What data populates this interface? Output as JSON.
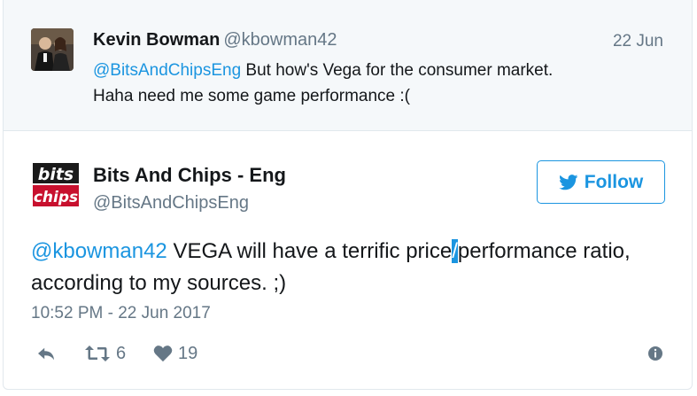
{
  "parent_tweet": {
    "author_name": "Kevin Bowman",
    "author_handle": "@kbowman42",
    "date": "22 Jun",
    "mention": "@BitsAndChipsEng",
    "text_line1_rest": " But how's Vega for the consumer market.",
    "text_line2": "Haha need me some game performance :("
  },
  "main_tweet": {
    "author_name": "Bits And Chips - Eng",
    "author_handle": "@BitsAndChipsEng",
    "logo_text_top": "bits",
    "logo_text_bottom": "chips",
    "follow_label": "Follow",
    "mention": "@kbowman42",
    "text_part1": " VEGA will have a terrific price",
    "text_cursor": "/",
    "text_part2": "performance ratio, according to my sources. ;)",
    "timestamp": "10:52 PM - 22 Jun 2017"
  },
  "actions": {
    "reply_icon": "reply-icon",
    "retweet_count": "6",
    "like_count": "19",
    "info_icon": "info-icon"
  },
  "colors": {
    "accent": "#1b95e0",
    "muted": "#657786",
    "parent_bg": "#f5f8fa"
  }
}
